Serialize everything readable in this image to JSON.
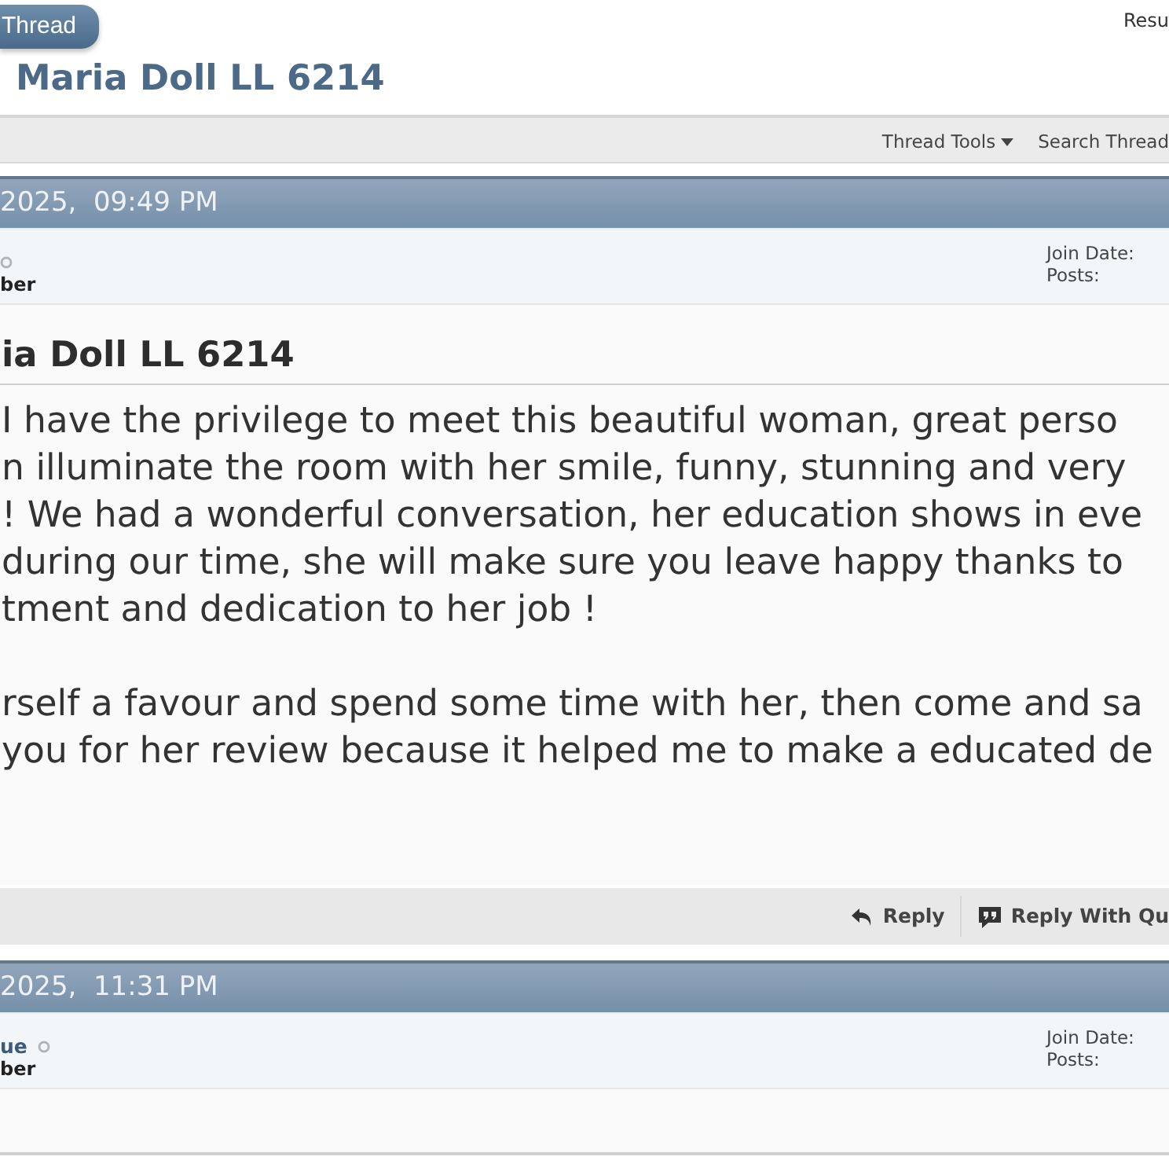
{
  "header": {
    "button": "Thread",
    "top_right_link": "Resu"
  },
  "thread_title": "Maria Doll LL 6214",
  "toolbar": [
    {
      "label": "Thread Tools",
      "dropdown": true
    },
    {
      "label": "Search Thread",
      "dropdown": false
    }
  ],
  "posts": [
    {
      "date": "2025,  09:49 PM",
      "online": false,
      "user_title": "ber",
      "info_labels": [
        "Join Date:",
        "Posts:"
      ],
      "title": "ia Doll LL 6214",
      "paragraphs": [
        [
          "I have the privilege to meet this beautiful woman, great perso",
          "n illuminate the room with her smile, funny, stunning and very",
          "! We had a wonderful conversation, her education shows in eve",
          "during our time, she will make sure you leave happy thanks to",
          "tment and dedication to her job !"
        ],
        [
          "rself a favour and spend some time with her, then come and sa",
          "you for her review because it helped me to make a educated de"
        ]
      ],
      "actions": [
        {
          "kind": "reply",
          "label": "Reply"
        },
        {
          "kind": "quote",
          "label": "Reply With Qu"
        }
      ]
    },
    {
      "date": "2025,  11:31 PM",
      "username": "ue",
      "online": false,
      "user_title": "ber",
      "info_labels": [
        "Join Date:",
        "Posts:"
      ]
    }
  ]
}
